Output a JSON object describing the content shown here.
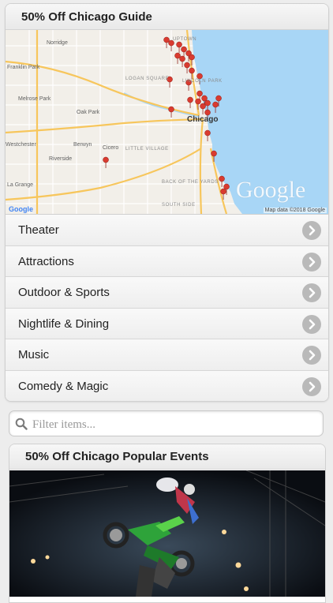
{
  "guide": {
    "title": "50% Off Chicago Guide",
    "map": {
      "labels": {
        "norridge": "Norridge",
        "franklin_park": "Franklin Park",
        "melrose_park": "Melrose Park",
        "oak_park": "Oak Park",
        "westchester": "Westchester",
        "berwyn": "Berwyn",
        "cicero": "Cicero",
        "little_village": "LITTLE VILLAGE",
        "riverside": "Riverside",
        "la_grange": "La Grange",
        "logan_square": "LOGAN SQUARE",
        "uptown": "UPTOWN",
        "lincoln_park": "LINCOLN PARK",
        "chicago": "Chicago",
        "back_of_the_yards": "BACK OF THE YARDS",
        "south_side": "SOUTH SIDE"
      },
      "watermark": "Google",
      "google_small": "Google",
      "credit": "Map data ©2018 Google",
      "colors": {
        "water": "#a8d6f6",
        "land": "#f2efe9",
        "highway": "#f7c65c",
        "pin": "#d93b30"
      }
    },
    "categories": [
      {
        "label": "Theater"
      },
      {
        "label": "Attractions"
      },
      {
        "label": "Outdoor & Sports"
      },
      {
        "label": "Nightlife & Dining"
      },
      {
        "label": "Music"
      },
      {
        "label": "Comedy & Magic"
      }
    ]
  },
  "filter": {
    "placeholder": "Filter items..."
  },
  "popular": {
    "title": "50% Off Chicago Popular Events"
  }
}
